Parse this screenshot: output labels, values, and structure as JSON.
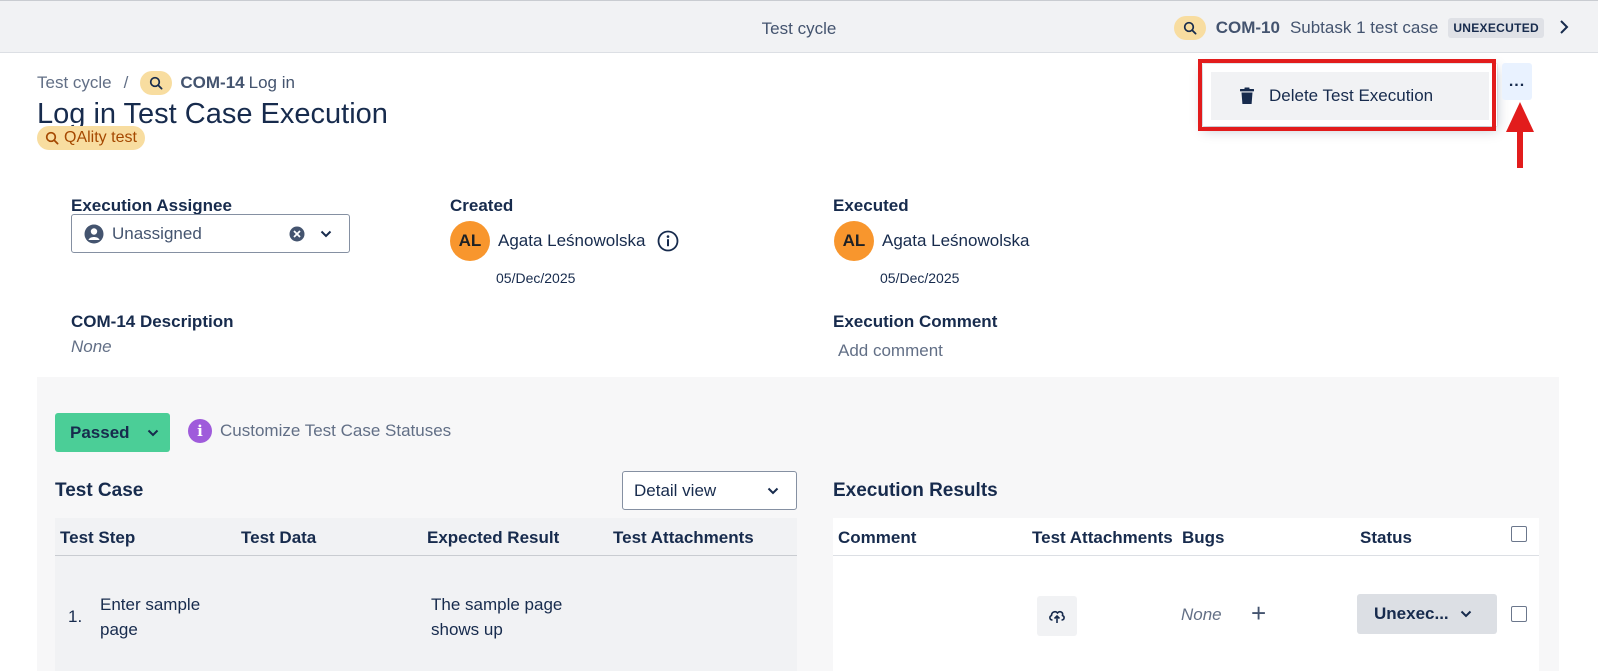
{
  "topbar": {
    "title": "Test cycle",
    "issue_key": "COM-10",
    "issue_summary": "Subtask 1 test case",
    "issue_status": "UNEXECUTED"
  },
  "breadcrumb": {
    "parent": "Test cycle",
    "separator": "/",
    "issue_key": "COM-14",
    "issue_summary": "Log in"
  },
  "page_title": "Log in Test Case Execution",
  "project_tag": "QAlity test",
  "menu": {
    "delete_label": "Delete Test Execution",
    "more_label": "..."
  },
  "fields": {
    "assignee_label": "Execution Assignee",
    "assignee_value": "Unassigned",
    "created_label": "Created",
    "created_user": "Agata Leśnowolska",
    "created_initials": "AL",
    "created_date": "05/Dec/2025",
    "executed_label": "Executed",
    "executed_user": "Agata Leśnowolska",
    "executed_initials": "AL",
    "executed_date": "05/Dec/2025",
    "description_label": "COM-14 Description",
    "description_value": "None",
    "comment_label": "Execution Comment",
    "comment_placeholder": "Add comment"
  },
  "execution": {
    "status": "Passed",
    "customize_label": "Customize Test Case Statuses",
    "info_glyph": "i"
  },
  "test_case": {
    "title": "Test Case",
    "view_select": "Detail view",
    "columns": [
      "Test Step",
      "Test Data",
      "Expected Result",
      "Test Attachments"
    ],
    "rows": [
      {
        "index": "1.",
        "step_line1": "Enter sample",
        "step_line2": "page",
        "expected_line1": "The sample page",
        "expected_line2": "shows up"
      }
    ]
  },
  "execution_results": {
    "title": "Execution Results",
    "columns": [
      "Comment",
      "Test Attachments",
      "Bugs",
      "Status"
    ],
    "rows": [
      {
        "bugs": "None",
        "add_bug": "+",
        "status": "Unexec..."
      }
    ]
  },
  "colors": {
    "accent_passed": "#4bce97",
    "highlight_red": "#e21c1c",
    "avatar_orange": "#f8962d",
    "tag_yellow": "#f8dda0"
  }
}
